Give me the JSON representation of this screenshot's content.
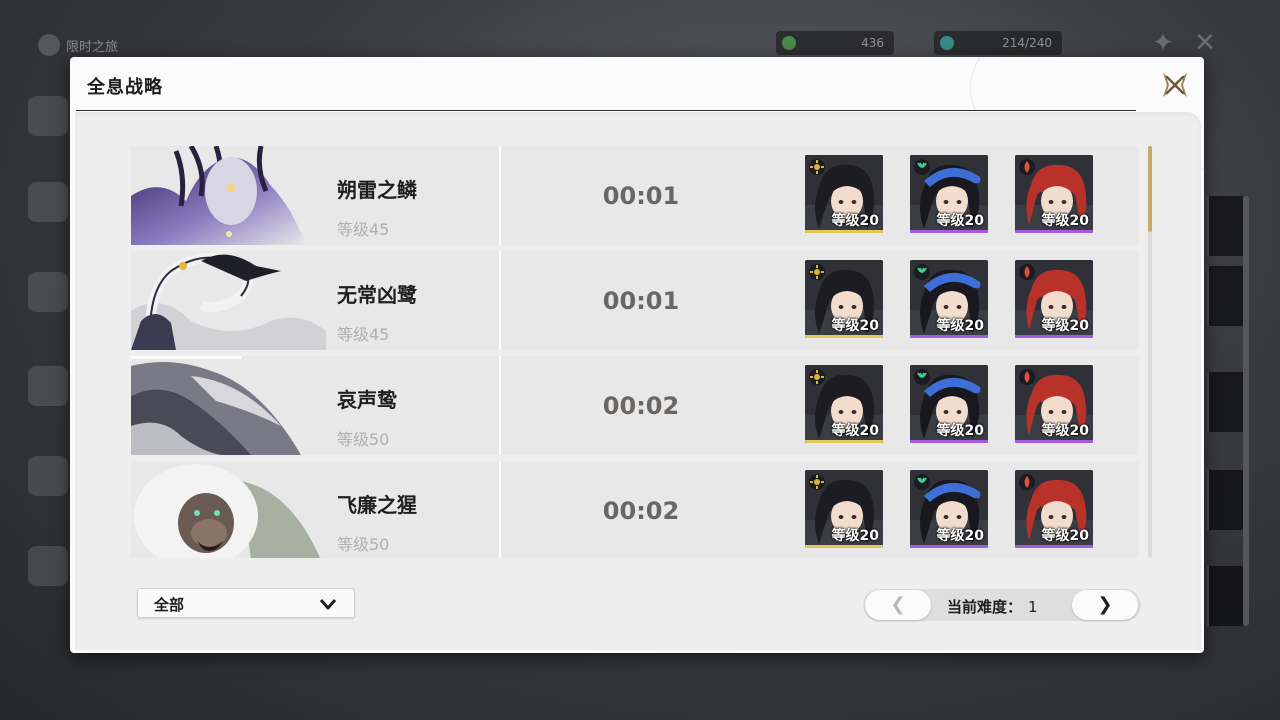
{
  "background": {
    "title": "限时之旅",
    "resource1": "436",
    "resource2": "214/240"
  },
  "dialog": {
    "title": "全息战略",
    "close_icon": "close-x-icon"
  },
  "bosses": [
    {
      "name": "朔雷之鳞",
      "level": "等级45",
      "time": "00:01"
    },
    {
      "name": "无常凶鹭",
      "level": "等级45",
      "time": "00:01"
    },
    {
      "name": "哀声鸷",
      "level": "等级50",
      "time": "00:02"
    },
    {
      "name": "飞廉之猩",
      "level": "等级50",
      "time": "00:02"
    }
  ],
  "team": [
    {
      "level": "等级20",
      "element": "spectro",
      "element_color": "#d9b23a",
      "rarity_color": "#e3c95a",
      "hair": "#1c1c22",
      "hat": ""
    },
    {
      "level": "等级20",
      "element": "aero",
      "element_color": "#3fcf8e",
      "rarity_color": "#a35be0",
      "hair": "#18181e",
      "hat": "#3e6fd8"
    },
    {
      "level": "等级20",
      "element": "fusion",
      "element_color": "#e0523a",
      "rarity_color": "#a35be0",
      "hair": "#b8322a",
      "hat": ""
    }
  ],
  "filter": {
    "label": "全部"
  },
  "pager": {
    "prev": "❮",
    "next": "❯",
    "label": "当前难度：",
    "value": "1"
  },
  "colors": {
    "accent_gold": "#c9a86a",
    "spectro": "#d9b23a",
    "aero": "#3fcf8e",
    "fusion": "#e0523a"
  }
}
